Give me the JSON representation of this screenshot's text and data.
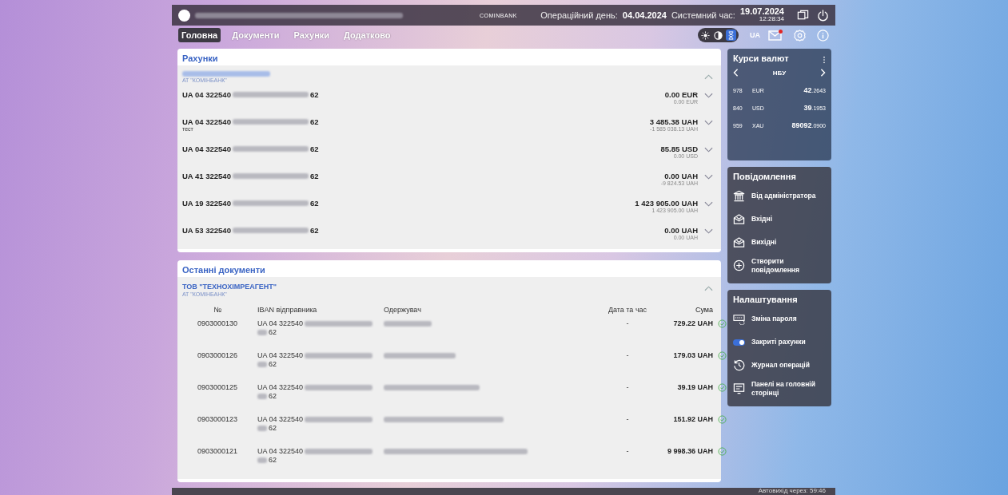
{
  "top_bar": {
    "brand": "COMINBANK",
    "operating_day_label": "Операційний день:",
    "operating_day": "04.04.2024",
    "system_time_label": "Системний час:",
    "system_date": "19.07.2024",
    "system_time": "12:28:34"
  },
  "nav": [
    {
      "label": "Головна",
      "selected": true
    },
    {
      "label": "Документи",
      "selected": false
    },
    {
      "label": "Рахунки",
      "selected": false
    },
    {
      "label": "Додатково",
      "selected": false
    }
  ],
  "theme_options": [
    {
      "kind": "sun",
      "selected": false
    },
    {
      "kind": "moon",
      "selected": false
    },
    {
      "kind": "auto",
      "selected": true
    }
  ],
  "language": "UA",
  "mail_unread": true,
  "accounts": {
    "title": "Рахунки",
    "bank": "АТ \"КОМІНБАНК\"",
    "expanded": true,
    "rows": [
      {
        "iban_start": "UA 04 322540",
        "iban_end": "62",
        "note": "",
        "amount": "0.00 EUR",
        "sub_amount": "0.00 EUR"
      },
      {
        "iban_start": "UA 04 322540",
        "iban_end": "62",
        "note": "тест",
        "amount": "3 485.38 UAH",
        "sub_amount": "-1 585 038.13 UAH"
      },
      {
        "iban_start": "UA 04 322540",
        "iban_end": "62",
        "note": "",
        "amount": "85.85 USD",
        "sub_amount": "0.00 USD"
      },
      {
        "iban_start": "UA 41 322540",
        "iban_end": "62",
        "note": "",
        "amount": "0.00 UAH",
        "sub_amount": "-9 824.53 UAH"
      },
      {
        "iban_start": "UA 19 322540",
        "iban_end": "62",
        "note": "",
        "amount": "1 423 905.00 UAH",
        "sub_amount": "1 423 905.00 UAH"
      },
      {
        "iban_start": "UA 53 322540",
        "iban_end": "62",
        "note": "",
        "amount": "0.00 UAH",
        "sub_amount": "0.00 UAH"
      }
    ]
  },
  "documents": {
    "title": "Останні документи",
    "company": "ТОВ \"ТЕХНОХІМРЕАГЕНТ\"",
    "bank": "АТ \"КОМІНБАНК\"",
    "expanded": true,
    "columns": [
      "№",
      "IBAN відправника",
      "Одержувач",
      "Дата та час",
      "Сума"
    ],
    "rows": [
      {
        "number": "0903000130",
        "iban_start": "UA 04 322540",
        "iban_end": "62",
        "date": "-",
        "amount": "729.22 UAH"
      },
      {
        "number": "0903000126",
        "iban_start": "UA 04 322540",
        "iban_end": "62",
        "date": "-",
        "amount": "179.03 UAH"
      },
      {
        "number": "0903000125",
        "iban_start": "UA 04 322540",
        "iban_end": "62",
        "date": "-",
        "amount": "39.19 UAH"
      },
      {
        "number": "0903000123",
        "iban_start": "UA 04 322540",
        "iban_end": "62",
        "date": "-",
        "amount": "151.92 UAH"
      },
      {
        "number": "0903000121",
        "iban_start": "UA 04 322540",
        "iban_end": "62",
        "date": "-",
        "amount": "9 998.36 UAH"
      }
    ]
  },
  "rates": {
    "title": "Курси валют",
    "source": "НБУ",
    "rows": [
      {
        "code": "978",
        "currency": "EUR",
        "rate": "**42**.2643"
      },
      {
        "code": "840",
        "currency": "USD",
        "rate": "**39**.1953"
      },
      {
        "code": "959",
        "currency": "XAU",
        "rate": "**89092**.0900"
      }
    ]
  },
  "messages": {
    "title": "Повідомлення",
    "items": [
      {
        "kind": "bank",
        "label": "Від адміністратора"
      },
      {
        "kind": "inbox",
        "label": "Вхідні"
      },
      {
        "kind": "outbox",
        "label": "Вихідні"
      },
      {
        "kind": "create",
        "label": "Створити повідомлення"
      }
    ]
  },
  "settings": {
    "title": "Налаштування",
    "items": [
      {
        "kind": "password",
        "label": "Зміна пароля"
      },
      {
        "kind": "toggle",
        "label": "Закриті рахунки",
        "on": true
      },
      {
        "kind": "history",
        "label": "Журнал операцій"
      },
      {
        "kind": "panels",
        "label": "Панелі на головній сторінці"
      }
    ]
  },
  "footer": {
    "autologout": "Автовихід через: 59:46"
  }
}
